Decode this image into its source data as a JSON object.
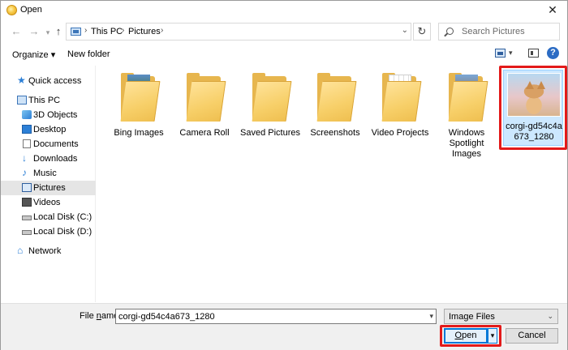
{
  "window": {
    "title": "Open",
    "close_glyph": "✕"
  },
  "nav": {
    "back_glyph": "←",
    "forward_glyph": "→",
    "up_glyph": "↑",
    "refresh_glyph": "↻"
  },
  "address": {
    "crumbs": [
      "This PC",
      "Pictures"
    ],
    "separator": "›",
    "dropdown_glyph": "⌄"
  },
  "search": {
    "placeholder": "Search Pictures"
  },
  "commands": {
    "organize": "Organize ▾",
    "new_folder": "New folder",
    "view_dropdown": "▾",
    "help": "?"
  },
  "sidebar": {
    "items": [
      {
        "label": "Quick access",
        "icon": "star-icon"
      },
      {
        "label": "This PC",
        "icon": "computer-icon"
      },
      {
        "label": "3D Objects",
        "icon": "cube-icon"
      },
      {
        "label": "Desktop",
        "icon": "desktop-icon"
      },
      {
        "label": "Documents",
        "icon": "document-icon"
      },
      {
        "label": "Downloads",
        "icon": "download-icon"
      },
      {
        "label": "Music",
        "icon": "music-icon"
      },
      {
        "label": "Pictures",
        "icon": "pictures-icon",
        "selected": true
      },
      {
        "label": "Videos",
        "icon": "video-icon"
      },
      {
        "label": "Local Disk (C:)",
        "icon": "drive-icon"
      },
      {
        "label": "Local Disk (D:)",
        "icon": "drive-icon"
      },
      {
        "label": "Network",
        "icon": "network-icon"
      }
    ]
  },
  "files": {
    "folders": [
      {
        "label": "Bing Images"
      },
      {
        "label": "Camera Roll"
      },
      {
        "label": "Saved Pictures"
      },
      {
        "label": "Screenshots"
      },
      {
        "label": "Video Projects"
      },
      {
        "label": "Windows Spotlight Images"
      }
    ],
    "selected_image": {
      "label": "corgi-gd54c4a673_1280",
      "icon": "corgi-thumbnail"
    }
  },
  "footer": {
    "file_name_label_pre": "File ",
    "file_name_label_key": "n",
    "file_name_label_post": "ame:",
    "file_name_value": "corgi-gd54c4a673_1280",
    "file_type": "Image Files",
    "open_label_key": "O",
    "open_label_rest": "pen",
    "open_split_glyph": "▾",
    "cancel_label": "Cancel"
  },
  "colors": {
    "highlight_outline": "#e31a1a",
    "selection": "#cce8ff",
    "accent": "#0078d7",
    "folder": "#f7cf68"
  }
}
